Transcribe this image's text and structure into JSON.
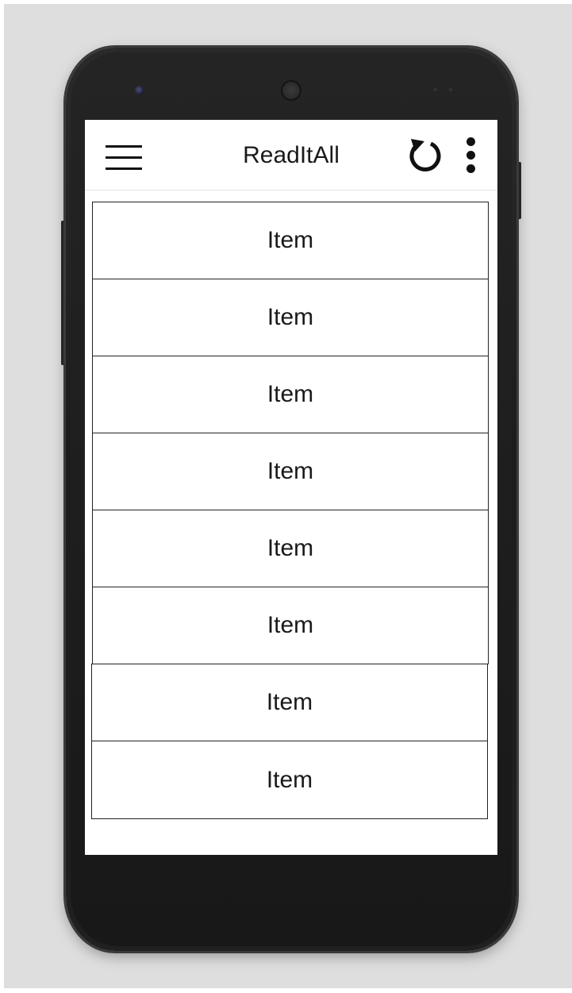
{
  "app": {
    "title": "ReadItAll"
  },
  "toolbar": {
    "menu_icon": "hamburger-menu-icon",
    "refresh_icon": "refresh-icon",
    "more_icon": "more-vertical-icon"
  },
  "list": {
    "items": [
      {
        "label": "Item"
      },
      {
        "label": "Item"
      },
      {
        "label": "Item"
      },
      {
        "label": "Item"
      },
      {
        "label": "Item"
      },
      {
        "label": "Item"
      },
      {
        "label": "Item"
      },
      {
        "label": "Item"
      }
    ]
  },
  "colors": {
    "background": "#dedede",
    "device": "#1c1c1c",
    "screen": "#ffffff",
    "text": "#1a1a1a",
    "border": "#222222"
  }
}
